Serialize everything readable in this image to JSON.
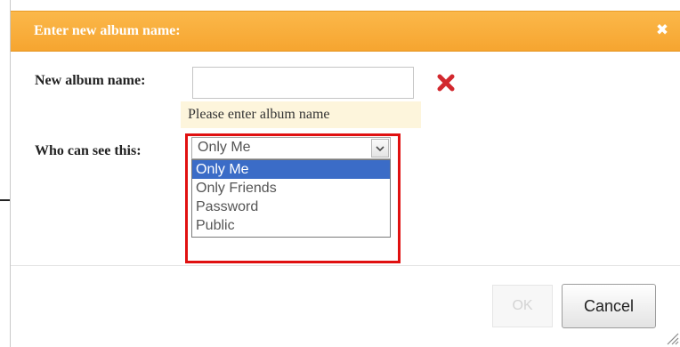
{
  "dialog": {
    "title": "Enter new album name:",
    "close_glyph": "✖"
  },
  "form": {
    "name_label": "New album name:",
    "name_value": "",
    "name_hint": "Please enter album name",
    "visibility_label": "Who can see this:",
    "visibility_selected": "Only Me",
    "visibility_options": [
      "Only Me",
      "Only Friends",
      "Password",
      "Public"
    ]
  },
  "buttons": {
    "ok_label": "OK",
    "cancel_label": "Cancel"
  },
  "icons": {
    "clear": "clear-x-icon",
    "close": "close-icon",
    "dropdown": "chevron-down-icon",
    "resize": "resize-grip-icon"
  },
  "colors": {
    "title_bar": "#f6a530",
    "clear_icon": "#d2282e",
    "highlight_border": "#e01010",
    "option_selected": "#3b6cc7",
    "hint_background": "#fdf5dc"
  }
}
